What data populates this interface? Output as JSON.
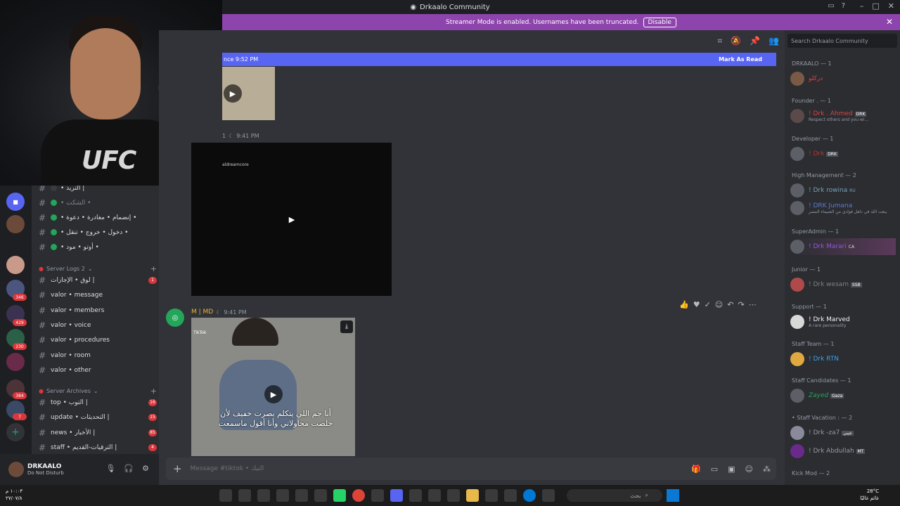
{
  "window": {
    "title": "Drkaalo Community"
  },
  "banner": {
    "text": "Streamer Mode is enabled. Usernames have been truncated.",
    "disable_label": "Disable"
  },
  "webcam": {
    "shirt_text": "UFC"
  },
  "rail": {
    "badges": [
      "346",
      "429",
      "230",
      "384",
      "7"
    ]
  },
  "channels": [
    {
      "name": "• التريد |",
      "dot": "#3a3b40"
    },
    {
      "name": "• الشكت •",
      "dot": "#23a55a"
    },
    {
      "name": "• إنضمام • مغادرة • دعوة •",
      "dot": "#23a55a"
    },
    {
      "name": "• دخول • خروج • تنقل •",
      "dot": "#23a55a"
    },
    {
      "name": "• أوتو • مود •",
      "dot": "#23a55a"
    }
  ],
  "server_logs": {
    "category": "Server Logs 2",
    "items": [
      {
        "name": "لوق • الإجازات |",
        "count": "1"
      },
      {
        "name": "valor • message",
        "count": ""
      },
      {
        "name": "valor • members",
        "count": ""
      },
      {
        "name": "valor • voice",
        "count": ""
      },
      {
        "name": "valor • procedures",
        "count": ""
      },
      {
        "name": "valor • room",
        "count": ""
      },
      {
        "name": "valor • other",
        "count": ""
      }
    ]
  },
  "server_archives": {
    "category": "Server Archives",
    "items": [
      {
        "name": "top • التوب |",
        "count": "16"
      },
      {
        "name": "update • التحديثات |",
        "count": "15"
      },
      {
        "name": "news • الأخبار |",
        "count": "85"
      },
      {
        "name": "staff • الترقيات-القديم |",
        "count": "4"
      }
    ]
  },
  "user": {
    "name": "DRKAALO",
    "status": "Do Not Disturb"
  },
  "chat": {
    "new_since": "nce 9:52 PM",
    "mark_read": "Mark As Read",
    "msg1_time": "9:41 PM",
    "msg1_prefix": "1",
    "video_caption": "aldreamcore",
    "msg2_author": "M | MD",
    "msg2_time": "9:41 PM",
    "tiktok_label": "TikTok",
    "subtitle_line1": "أنا جم اللي يتكلم بصرت خفيف لأن",
    "subtitle_line2": "خلصت محاولاتي وأنا أقول ماسمعت",
    "composer_placeholder": "Message #tiktok • التيك"
  },
  "members": {
    "search_placeholder": "Search Drkaalo Community",
    "roles": [
      {
        "label": "DRKAALO — 1",
        "members": [
          {
            "name": "دركلو",
            "color": "#e04040",
            "sub": ""
          }
        ]
      },
      {
        "label": "Founder . — 1",
        "members": [
          {
            "name": "! Drk . Ahmed",
            "color": "#e04040",
            "sub": "Respect others and you wi..."
          }
        ]
      },
      {
        "label": "Developer — 1",
        "members": [
          {
            "name": "! Drk",
            "color": "#c03030",
            "sub": ""
          }
        ]
      },
      {
        "label": "High Management — 2",
        "members": [
          {
            "name": "! Drk rowina",
            "color": "#7aa0b8",
            "sub": ""
          },
          {
            "name": "! DRK Jumana",
            "color": "#5b7bd8",
            "sub": "يبعت الله في دلعل فوادي من الشيماء المسر"
          }
        ]
      },
      {
        "label": "SuperAdmin — 1",
        "members": [
          {
            "name": "! Drk Marari",
            "color": "#8e5ad8",
            "sub": ""
          }
        ]
      },
      {
        "label": "Junior — 1",
        "members": [
          {
            "name": "! Drk wesam",
            "color": "#808080",
            "sub": ""
          }
        ]
      },
      {
        "label": "Support — 1",
        "members": [
          {
            "name": "! Drk Marved",
            "color": "#f2f3f5",
            "sub": "A rare personality"
          }
        ]
      },
      {
        "label": "Staff Team — 1",
        "members": [
          {
            "name": "! Drk RTN",
            "color": "#3ba0f0",
            "sub": ""
          }
        ]
      },
      {
        "label": "Staff Candidates — 1",
        "members": [
          {
            "name": "Zayed",
            "color": "#23a55a",
            "sub": ""
          }
        ]
      },
      {
        "label": "• Staff Vacation : — 2",
        "members": [
          {
            "name": "! Drk -za7",
            "color": "#949ba4",
            "sub": ""
          },
          {
            "name": "! Drk Abdullah",
            "color": "#949ba4",
            "sub": ""
          }
        ]
      },
      {
        "label": "Kick Mod — 2",
        "members": []
      }
    ],
    "extra_tags": {
      "founder_tag": "DRK",
      "developer_tag": "DRK",
      "jumana_tag": "",
      "marari_tag": "CA",
      "wesam_tag": "SSB",
      "zayed_tag": "Gaza",
      "abdullah_tag": "MT",
      "rowina_tag": "RU",
      "za7_tag": "جيبي"
    }
  },
  "taskbar": {
    "time": "١٠:٠٣ م",
    "date": "٢٧/٠٧/٨",
    "search_text": "بحث",
    "temp": "28°C",
    "weather": "غائم غالبًا"
  },
  "colors": {
    "banner": "#8e44ad",
    "newbar": "#5865f2",
    "bg_chat": "#313338",
    "bg_sidebar": "#2b2d31"
  }
}
